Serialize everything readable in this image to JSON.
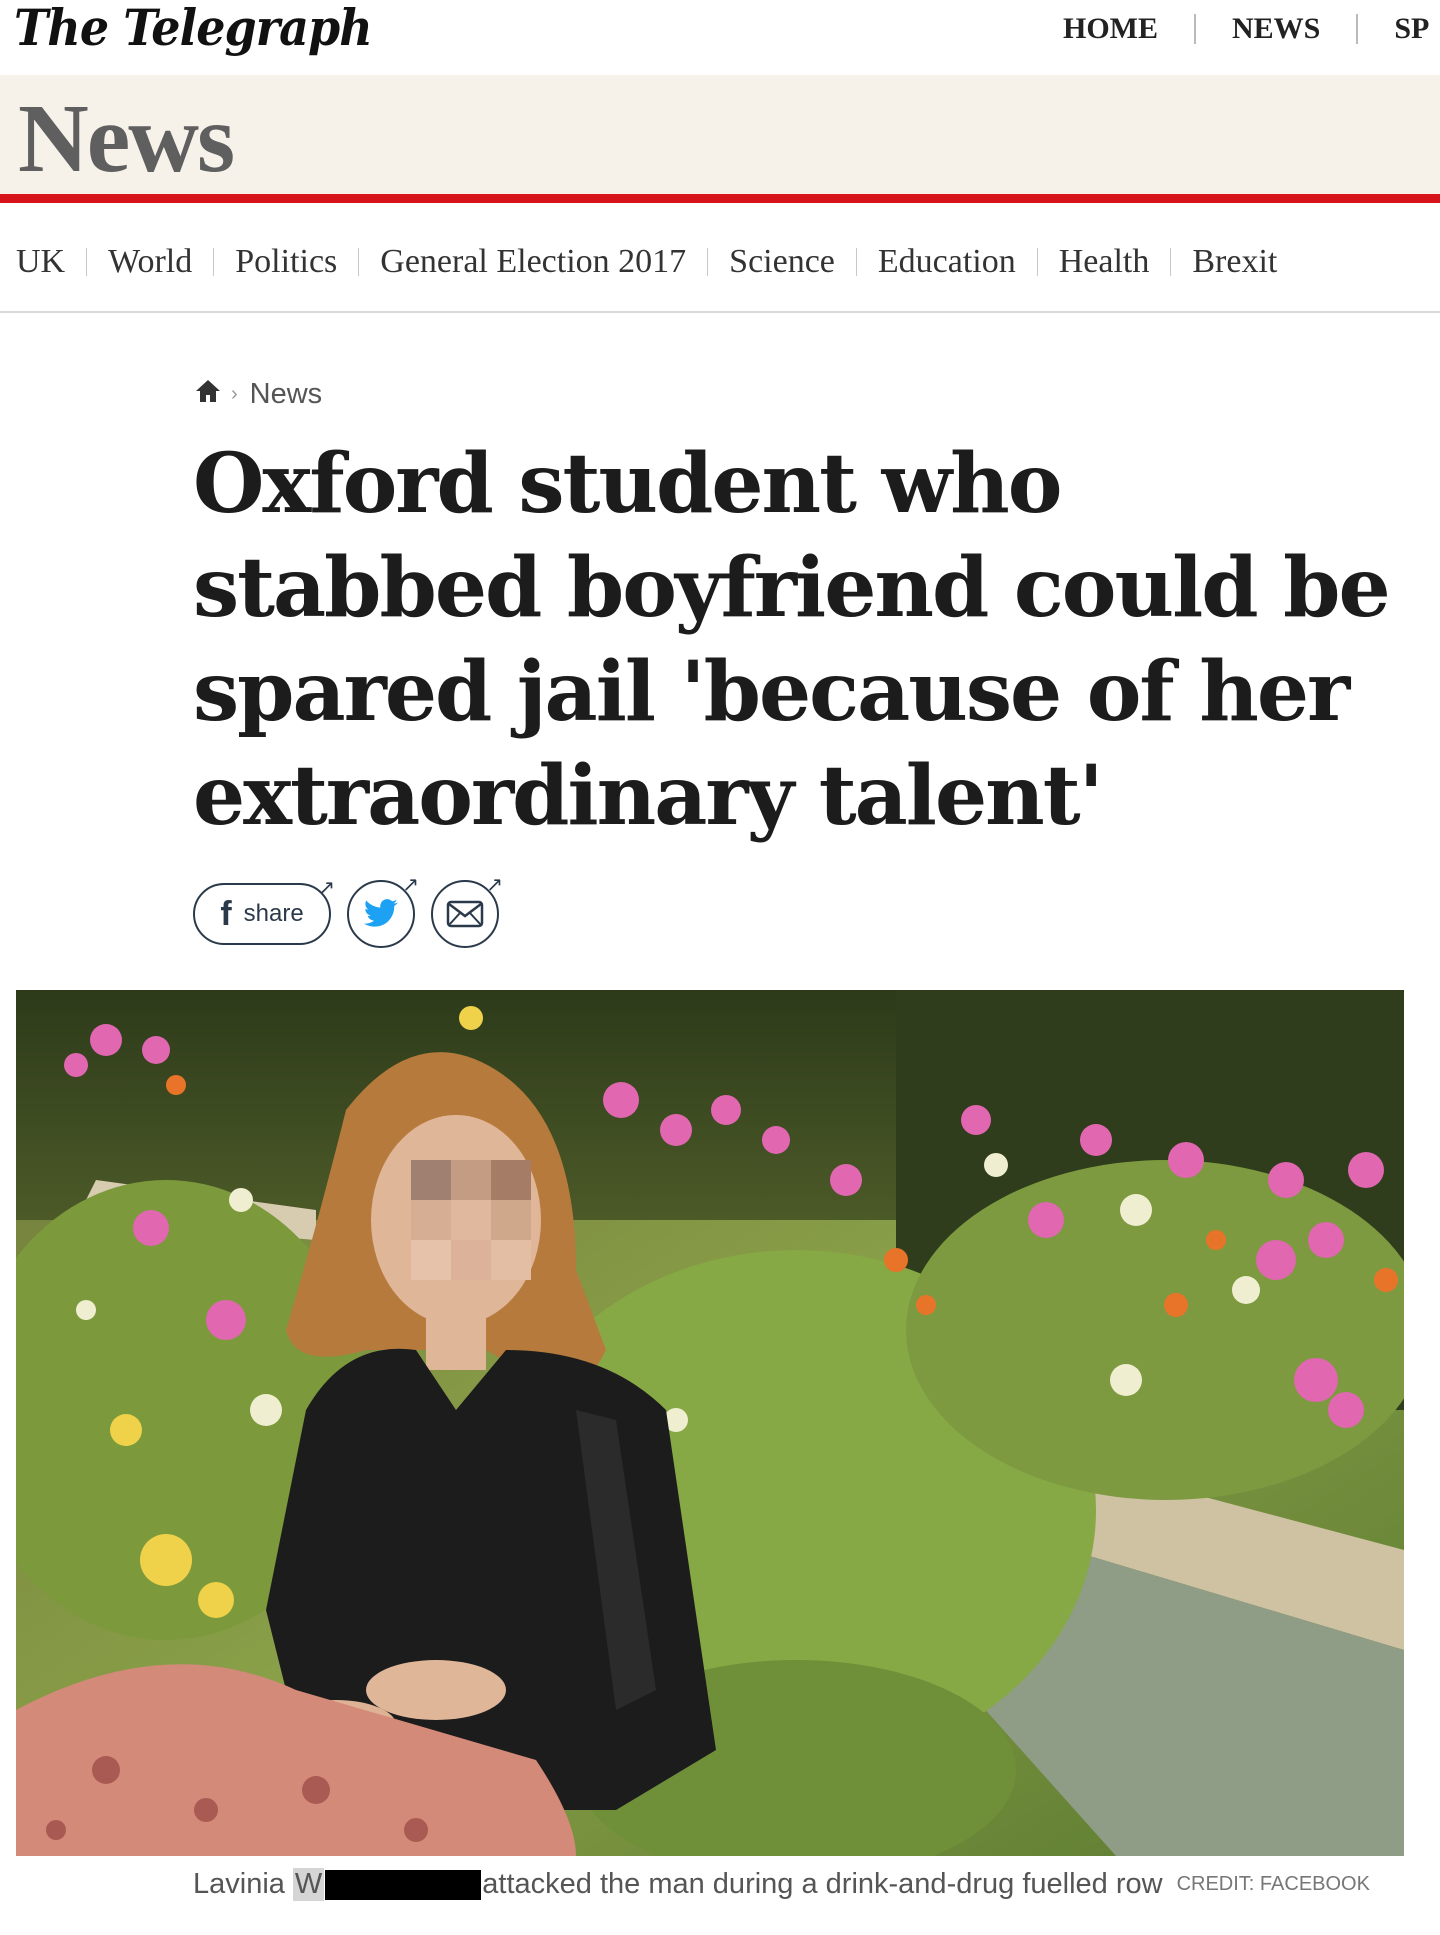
{
  "site": {
    "logo": "The Telegraph",
    "top_nav": [
      "HOME",
      "NEWS",
      "SP"
    ]
  },
  "section": {
    "title": "News"
  },
  "sub_nav": [
    "UK",
    "World",
    "Politics",
    "General Election 2017",
    "Science",
    "Education",
    "Health",
    "Brexit"
  ],
  "article": {
    "breadcrumb": "News",
    "headline": "Oxford student who stabbed boyfriend could be spared jail 'because of her extraordinary talent'",
    "share_label": "share",
    "caption_name_start": "Lavinia",
    "caption_initial": "W",
    "caption_rest": "attacked the man during a drink-and-drug fuelled row",
    "credit": "CREDIT: FACEBOOK"
  },
  "colors": {
    "accent_red": "#d7141a",
    "banner_bg": "#f6f2ea"
  }
}
